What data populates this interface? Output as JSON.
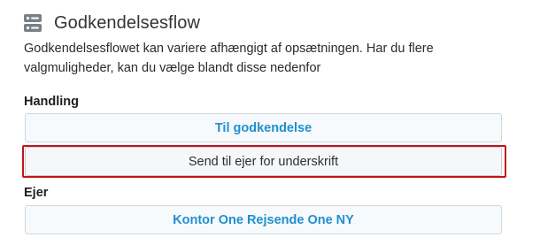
{
  "header": {
    "title": "Godkendelsesflow",
    "icon": "server-icon"
  },
  "description": "Godkendelsesflowet kan variere afhængigt af opsætningen. Har du flere valgmuligheder, kan du vælge blandt disse nedenfor",
  "handling": {
    "label": "Handling",
    "options": [
      {
        "label": "Til godkendelse",
        "selected": true
      },
      {
        "label": "Send til ejer for underskrift",
        "selected": false,
        "focused": true
      }
    ]
  },
  "owner": {
    "label": "Ejer",
    "options": [
      {
        "label": "Kontor One Rejsende One NY",
        "selected": true
      }
    ]
  },
  "colors": {
    "accent": "#1f8fd0",
    "focus": "#c0151b",
    "border": "#cfd6dc"
  }
}
